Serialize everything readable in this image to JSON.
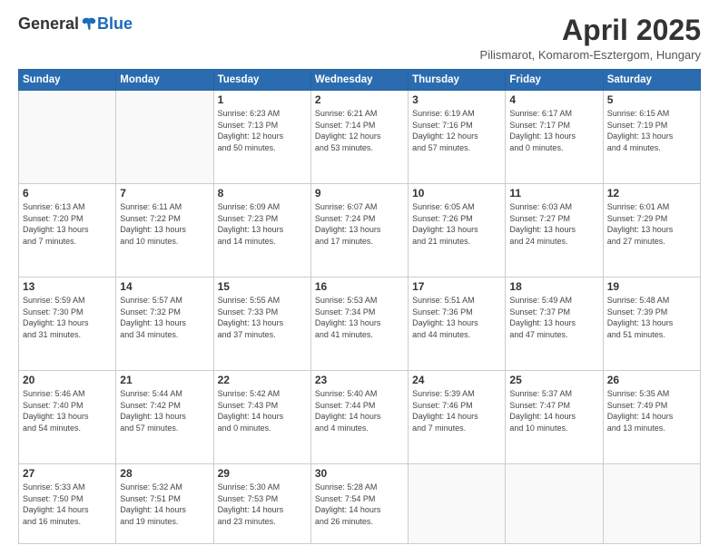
{
  "logo": {
    "general": "General",
    "blue": "Blue"
  },
  "header": {
    "title": "April 2025",
    "subtitle": "Pilismarot, Komarom-Esztergom, Hungary"
  },
  "days_of_week": [
    "Sunday",
    "Monday",
    "Tuesday",
    "Wednesday",
    "Thursday",
    "Friday",
    "Saturday"
  ],
  "weeks": [
    [
      {
        "day": "",
        "info": ""
      },
      {
        "day": "",
        "info": ""
      },
      {
        "day": "1",
        "info": "Sunrise: 6:23 AM\nSunset: 7:13 PM\nDaylight: 12 hours\nand 50 minutes."
      },
      {
        "day": "2",
        "info": "Sunrise: 6:21 AM\nSunset: 7:14 PM\nDaylight: 12 hours\nand 53 minutes."
      },
      {
        "day": "3",
        "info": "Sunrise: 6:19 AM\nSunset: 7:16 PM\nDaylight: 12 hours\nand 57 minutes."
      },
      {
        "day": "4",
        "info": "Sunrise: 6:17 AM\nSunset: 7:17 PM\nDaylight: 13 hours\nand 0 minutes."
      },
      {
        "day": "5",
        "info": "Sunrise: 6:15 AM\nSunset: 7:19 PM\nDaylight: 13 hours\nand 4 minutes."
      }
    ],
    [
      {
        "day": "6",
        "info": "Sunrise: 6:13 AM\nSunset: 7:20 PM\nDaylight: 13 hours\nand 7 minutes."
      },
      {
        "day": "7",
        "info": "Sunrise: 6:11 AM\nSunset: 7:22 PM\nDaylight: 13 hours\nand 10 minutes."
      },
      {
        "day": "8",
        "info": "Sunrise: 6:09 AM\nSunset: 7:23 PM\nDaylight: 13 hours\nand 14 minutes."
      },
      {
        "day": "9",
        "info": "Sunrise: 6:07 AM\nSunset: 7:24 PM\nDaylight: 13 hours\nand 17 minutes."
      },
      {
        "day": "10",
        "info": "Sunrise: 6:05 AM\nSunset: 7:26 PM\nDaylight: 13 hours\nand 21 minutes."
      },
      {
        "day": "11",
        "info": "Sunrise: 6:03 AM\nSunset: 7:27 PM\nDaylight: 13 hours\nand 24 minutes."
      },
      {
        "day": "12",
        "info": "Sunrise: 6:01 AM\nSunset: 7:29 PM\nDaylight: 13 hours\nand 27 minutes."
      }
    ],
    [
      {
        "day": "13",
        "info": "Sunrise: 5:59 AM\nSunset: 7:30 PM\nDaylight: 13 hours\nand 31 minutes."
      },
      {
        "day": "14",
        "info": "Sunrise: 5:57 AM\nSunset: 7:32 PM\nDaylight: 13 hours\nand 34 minutes."
      },
      {
        "day": "15",
        "info": "Sunrise: 5:55 AM\nSunset: 7:33 PM\nDaylight: 13 hours\nand 37 minutes."
      },
      {
        "day": "16",
        "info": "Sunrise: 5:53 AM\nSunset: 7:34 PM\nDaylight: 13 hours\nand 41 minutes."
      },
      {
        "day": "17",
        "info": "Sunrise: 5:51 AM\nSunset: 7:36 PM\nDaylight: 13 hours\nand 44 minutes."
      },
      {
        "day": "18",
        "info": "Sunrise: 5:49 AM\nSunset: 7:37 PM\nDaylight: 13 hours\nand 47 minutes."
      },
      {
        "day": "19",
        "info": "Sunrise: 5:48 AM\nSunset: 7:39 PM\nDaylight: 13 hours\nand 51 minutes."
      }
    ],
    [
      {
        "day": "20",
        "info": "Sunrise: 5:46 AM\nSunset: 7:40 PM\nDaylight: 13 hours\nand 54 minutes."
      },
      {
        "day": "21",
        "info": "Sunrise: 5:44 AM\nSunset: 7:42 PM\nDaylight: 13 hours\nand 57 minutes."
      },
      {
        "day": "22",
        "info": "Sunrise: 5:42 AM\nSunset: 7:43 PM\nDaylight: 14 hours\nand 0 minutes."
      },
      {
        "day": "23",
        "info": "Sunrise: 5:40 AM\nSunset: 7:44 PM\nDaylight: 14 hours\nand 4 minutes."
      },
      {
        "day": "24",
        "info": "Sunrise: 5:39 AM\nSunset: 7:46 PM\nDaylight: 14 hours\nand 7 minutes."
      },
      {
        "day": "25",
        "info": "Sunrise: 5:37 AM\nSunset: 7:47 PM\nDaylight: 14 hours\nand 10 minutes."
      },
      {
        "day": "26",
        "info": "Sunrise: 5:35 AM\nSunset: 7:49 PM\nDaylight: 14 hours\nand 13 minutes."
      }
    ],
    [
      {
        "day": "27",
        "info": "Sunrise: 5:33 AM\nSunset: 7:50 PM\nDaylight: 14 hours\nand 16 minutes."
      },
      {
        "day": "28",
        "info": "Sunrise: 5:32 AM\nSunset: 7:51 PM\nDaylight: 14 hours\nand 19 minutes."
      },
      {
        "day": "29",
        "info": "Sunrise: 5:30 AM\nSunset: 7:53 PM\nDaylight: 14 hours\nand 23 minutes."
      },
      {
        "day": "30",
        "info": "Sunrise: 5:28 AM\nSunset: 7:54 PM\nDaylight: 14 hours\nand 26 minutes."
      },
      {
        "day": "",
        "info": ""
      },
      {
        "day": "",
        "info": ""
      },
      {
        "day": "",
        "info": ""
      }
    ]
  ]
}
